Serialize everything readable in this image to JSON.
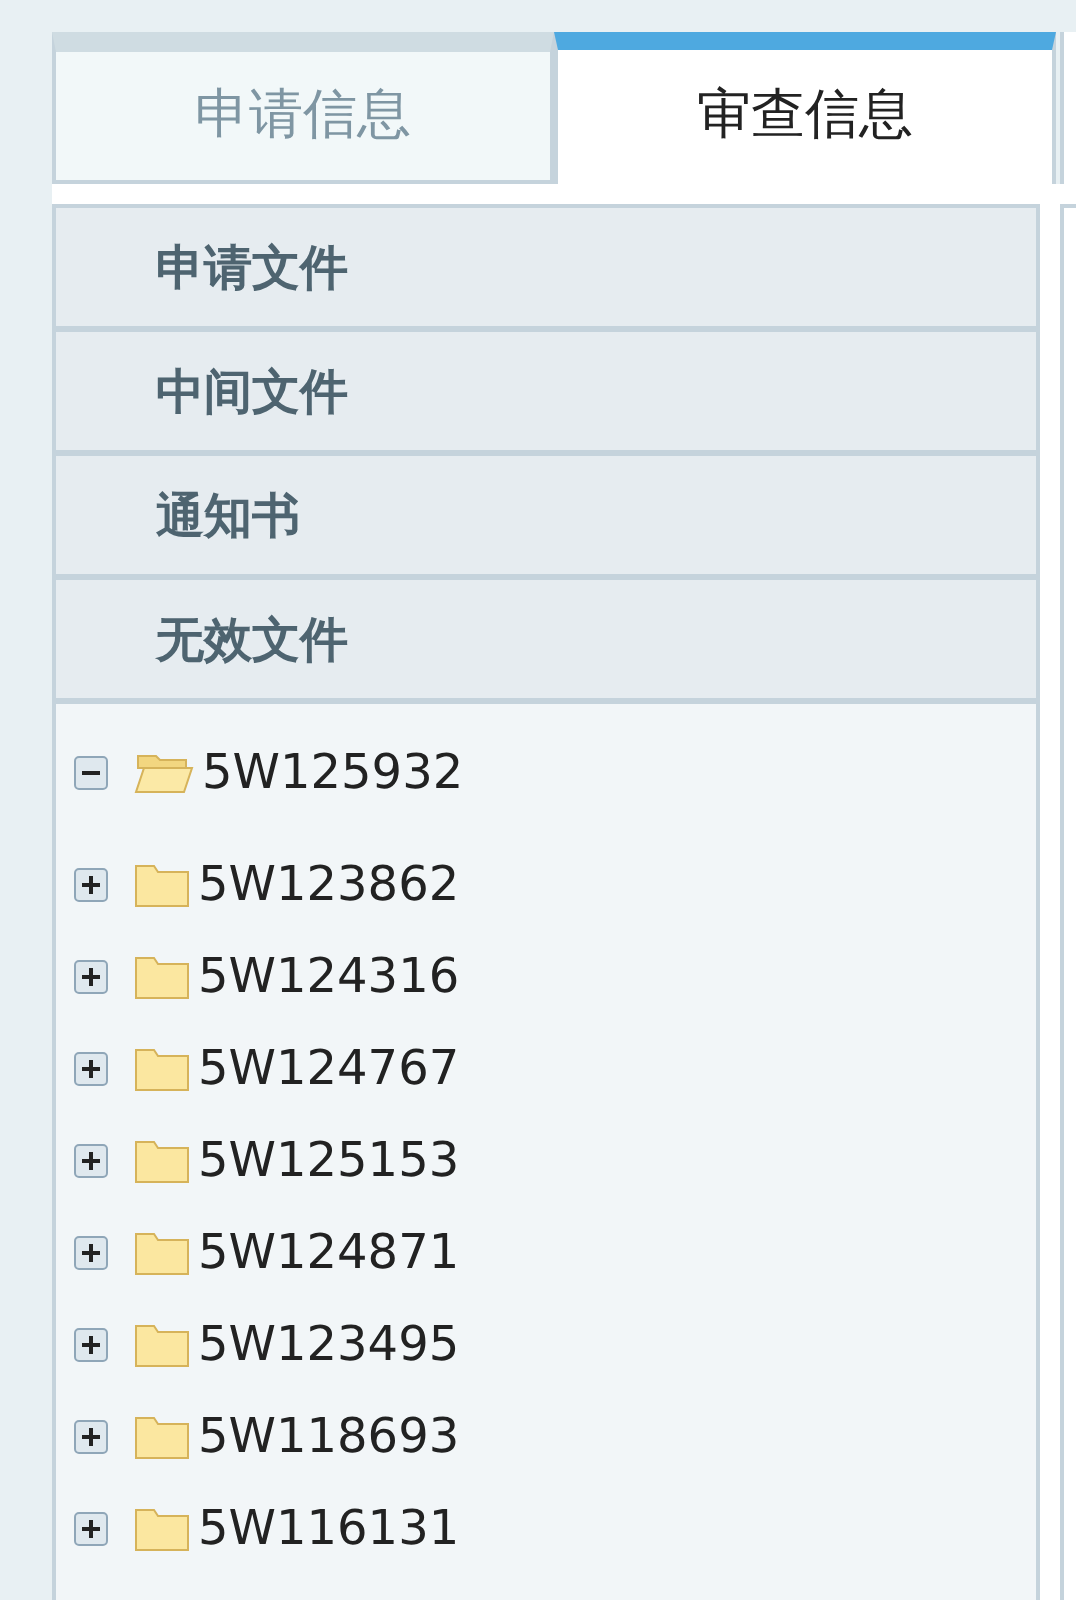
{
  "tabs": [
    {
      "label": "申请信息",
      "selected": false
    },
    {
      "label": "审查信息",
      "selected": true
    }
  ],
  "sections": [
    {
      "label": "申请文件"
    },
    {
      "label": "中间文件"
    },
    {
      "label": "通知书"
    },
    {
      "label": "无效文件"
    }
  ],
  "tree": [
    {
      "label": "5W125932",
      "expanded": true
    },
    {
      "label": "5W123862",
      "expanded": false
    },
    {
      "label": "5W124316",
      "expanded": false
    },
    {
      "label": "5W124767",
      "expanded": false
    },
    {
      "label": "5W125153",
      "expanded": false
    },
    {
      "label": "5W124871",
      "expanded": false
    },
    {
      "label": "5W123495",
      "expanded": false
    },
    {
      "label": "5W118693",
      "expanded": false
    },
    {
      "label": "5W116131",
      "expanded": false
    }
  ]
}
